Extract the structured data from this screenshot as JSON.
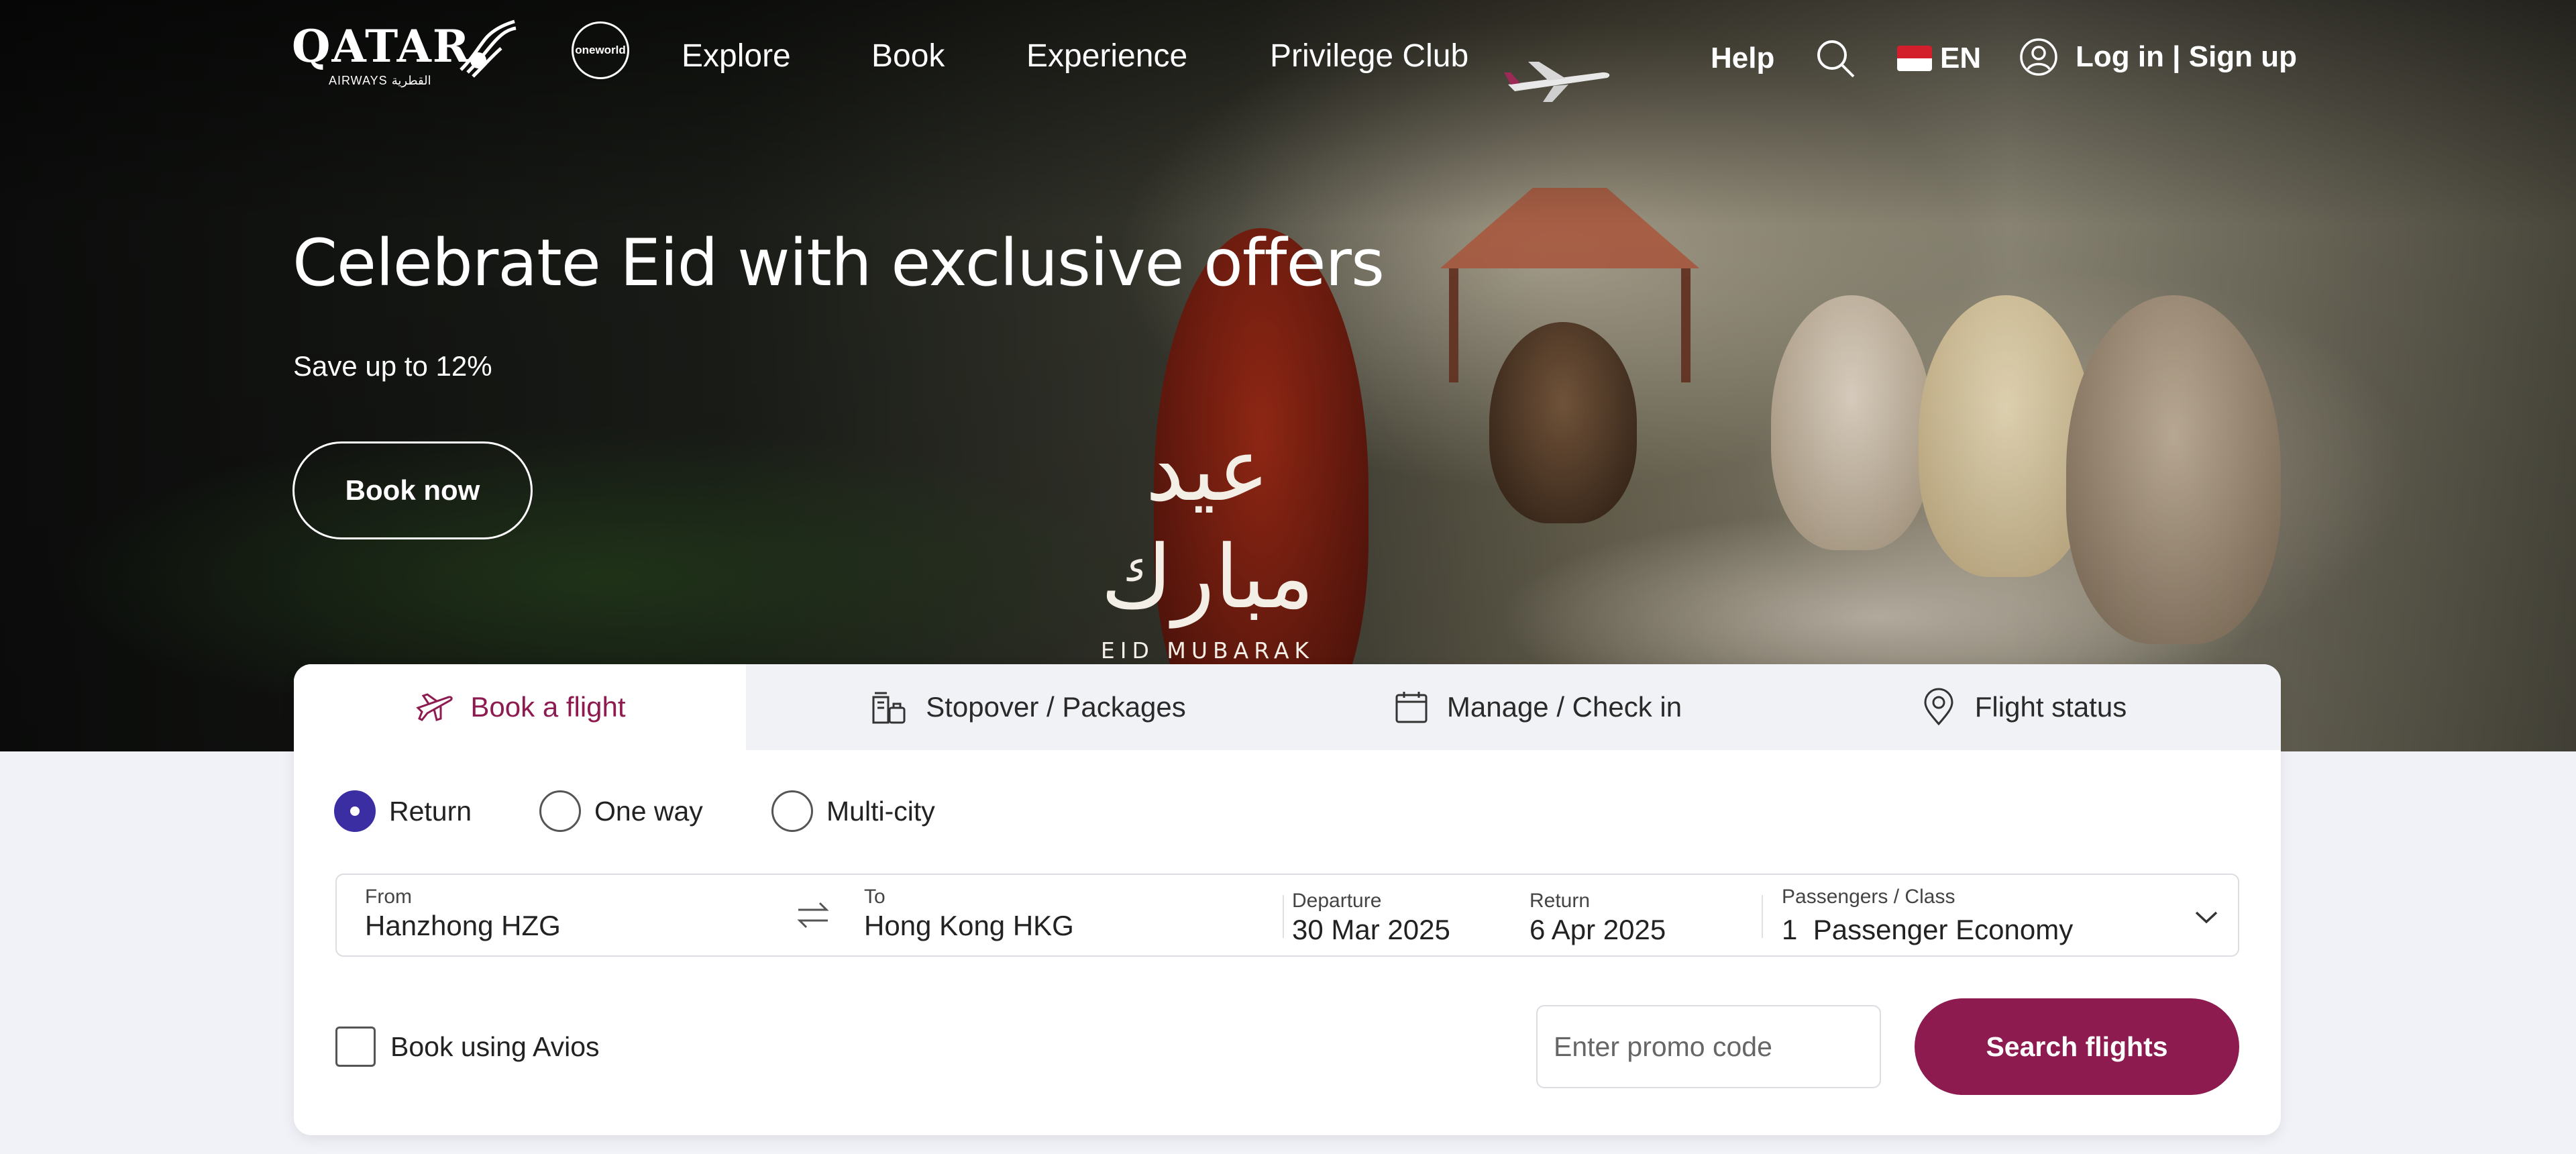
{
  "nav": {
    "logo": {
      "wordmark": "QATAR",
      "sub": "AIRWAYS القطرية"
    },
    "alliance": "oneworld",
    "links": [
      "Explore",
      "Book",
      "Experience",
      "Privilege Club"
    ],
    "help": "Help",
    "language": "EN",
    "login": "Log in | Sign up"
  },
  "hero": {
    "title": "Celebrate Eid with exclusive offers",
    "subtitle": "Save up to 12%",
    "cta": "Book now",
    "eid_arabic": "عيد مبارك",
    "eid_english": "EID MUBARAK"
  },
  "widget": {
    "tabs": [
      {
        "label": "Book a flight",
        "icon": "plane-icon",
        "active": true
      },
      {
        "label": "Stopover / Packages",
        "icon": "hotel-luggage-icon",
        "active": false
      },
      {
        "label": "Manage / Check in",
        "icon": "calendar-icon",
        "active": false
      },
      {
        "label": "Flight status",
        "icon": "location-pin-icon",
        "active": false
      }
    ],
    "trip_types": [
      {
        "label": "Return",
        "selected": true
      },
      {
        "label": "One way",
        "selected": false
      },
      {
        "label": "Multi-city",
        "selected": false
      }
    ],
    "from": {
      "label": "From",
      "value": "Hanzhong HZG"
    },
    "to": {
      "label": "To",
      "value": "Hong Kong HKG"
    },
    "departure": {
      "label": "Departure",
      "value": "30 Mar 2025"
    },
    "return": {
      "label": "Return",
      "value": "6 Apr 2025"
    },
    "passengers": {
      "label": "Passengers / Class",
      "value": "1  Passenger Economy"
    },
    "avios": {
      "label": "Book using Avios",
      "checked": false
    },
    "promo": {
      "placeholder": "Enter promo code",
      "value": ""
    },
    "search_button": "Search flights"
  },
  "colors": {
    "brand": "#8d1b4f",
    "radio_selected": "#3b2ea3",
    "page_bg": "#f1f1f8"
  }
}
